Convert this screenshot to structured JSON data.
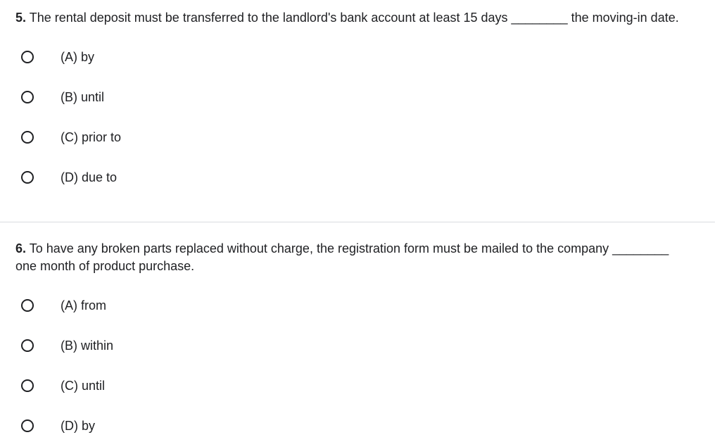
{
  "questions": [
    {
      "number": "5.",
      "text": "The rental deposit must be transferred to the landlord's bank account at least 15 days ________ the moving-in date.",
      "options": [
        {
          "label": "(A) by"
        },
        {
          "label": "(B) until"
        },
        {
          "label": "(C) prior to"
        },
        {
          "label": "(D) due to"
        }
      ]
    },
    {
      "number": "6.",
      "text": "To have any broken parts replaced without charge, the registration form must be mailed to the company ________ one month of product purchase.",
      "options": [
        {
          "label": "(A) from"
        },
        {
          "label": "(B) within"
        },
        {
          "label": "(C) until"
        },
        {
          "label": "(D) by"
        }
      ]
    }
  ]
}
